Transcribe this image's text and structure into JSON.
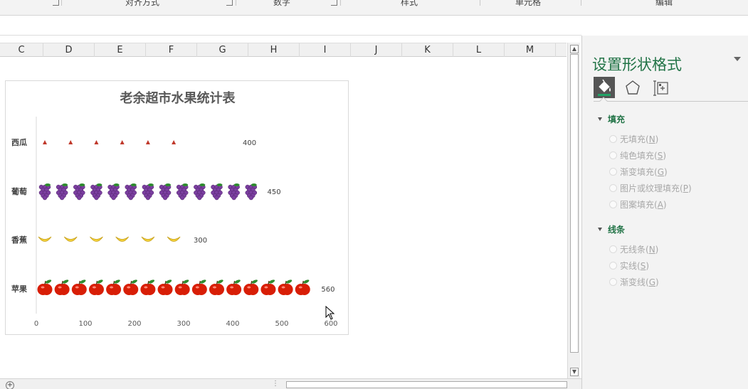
{
  "ribbon": {
    "groups": [
      "对齐方式",
      "数字",
      "样式",
      "单元格",
      "编辑"
    ]
  },
  "columns": [
    "C",
    "D",
    "E",
    "F",
    "G",
    "H",
    "I",
    "J",
    "K",
    "L",
    "M"
  ],
  "chart_data": {
    "type": "bar",
    "orientation": "horizontal",
    "title": "老余超市水果统计表",
    "categories": [
      "苹果",
      "香蕉",
      "葡萄",
      "西瓜"
    ],
    "values": [
      560,
      300,
      450,
      400
    ],
    "data_labels": [
      "560",
      "300",
      "450",
      "400"
    ],
    "picture_fill_icons": [
      "apple-icon",
      "banana-icon",
      "grape-icon",
      "watermelon-icon"
    ],
    "xlim": [
      0,
      600
    ],
    "xticks": [
      "0",
      "100",
      "200",
      "300",
      "400",
      "500",
      "600"
    ],
    "grid": false,
    "legend": "none",
    "colors": {
      "apple": "#d81e06",
      "banana": "#f5d33a",
      "grape": "#7b3fa0",
      "watermelon": "#c0392b",
      "leaf": "#2e8b2e"
    }
  },
  "panel": {
    "title": "设置形状格式",
    "tabs": [
      "fill-line-icon",
      "effects-pentagon-icon",
      "size-properties-icon"
    ],
    "sections": [
      {
        "label": "填充",
        "options": [
          {
            "label": "无填充(",
            "key": "N",
            "suffix": ")"
          },
          {
            "label": "纯色填充(",
            "key": "S",
            "suffix": ")"
          },
          {
            "label": "渐变填充(",
            "key": "G",
            "suffix": ")"
          },
          {
            "label": "图片或纹理填充(",
            "key": "P",
            "suffix": ")"
          },
          {
            "label": "图案填充(",
            "key": "A",
            "suffix": ")"
          }
        ]
      },
      {
        "label": "线条",
        "options": [
          {
            "label": "无线条(",
            "key": "N",
            "suffix": ")"
          },
          {
            "label": "实线(",
            "key": "S",
            "suffix": ")"
          },
          {
            "label": "渐变线(",
            "key": "G",
            "suffix": ")"
          }
        ]
      }
    ],
    "accent": "#217346"
  },
  "bottombar": {
    "add_sheet": "+",
    "dots": "⋮"
  }
}
